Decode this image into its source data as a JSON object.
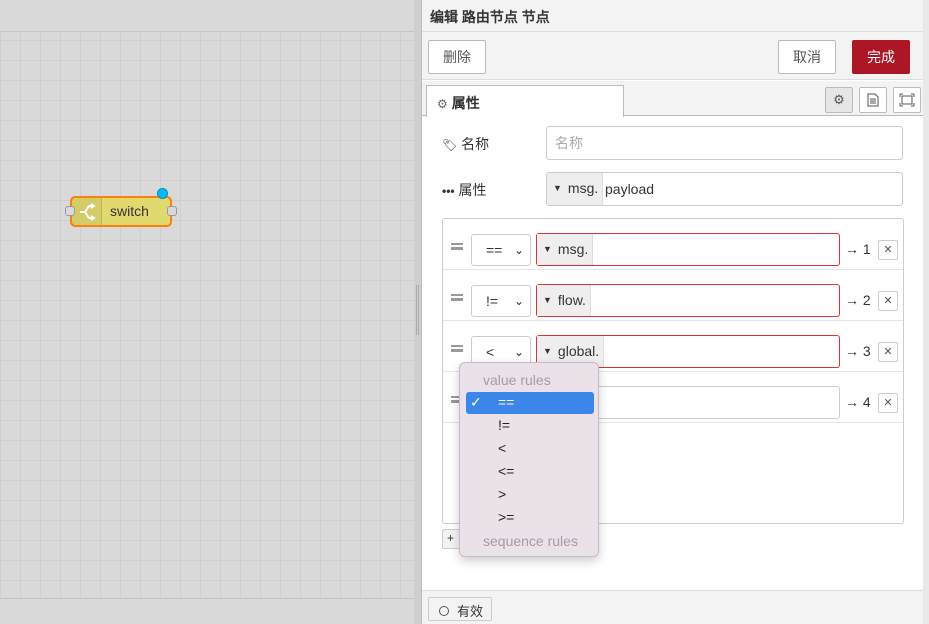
{
  "workspace": {
    "node": {
      "label": "switch",
      "icon": "switch-icon"
    }
  },
  "tray": {
    "title": "编辑 路由节点 节点",
    "toolbar": {
      "delete_label": "删除",
      "cancel_label": "取消",
      "done_label": "完成"
    },
    "tabs": {
      "properties_label": "属性",
      "properties_icon": "gear-icon",
      "buttons": [
        "gear-icon",
        "document-icon",
        "frame-icon"
      ]
    },
    "form": {
      "name_label": "名称",
      "name_placeholder": "名称",
      "name_icon": "tag-icon",
      "property_label": "属性",
      "property_icon": "ellipsis-icon",
      "property_type": "msg.",
      "property_value": "payload"
    },
    "rules": [
      {
        "operator": "==",
        "type": "msg.",
        "value": "",
        "output": "→ 1"
      },
      {
        "operator": "!=",
        "type": "flow.",
        "value": "",
        "output": "→ 2"
      },
      {
        "operator": "<",
        "type": "global.",
        "value": "",
        "output": "→ 3"
      },
      {
        "operator": "",
        "type": "",
        "value": "",
        "output": "→ 4"
      }
    ],
    "add_rule_label": "+",
    "dropdown": {
      "group_value": "value rules",
      "items": [
        "==",
        "!=",
        "<",
        "<=",
        ">",
        ">="
      ],
      "selected": "==",
      "group_sequence": "sequence rules"
    },
    "footer": {
      "enabled_label": "有效"
    }
  },
  "colors": {
    "accent": "#ad1625",
    "selected": "#3b86e8",
    "node_fill": "#e2d96e",
    "node_border": "#ff7f0e",
    "error_border": "#dd3333"
  }
}
